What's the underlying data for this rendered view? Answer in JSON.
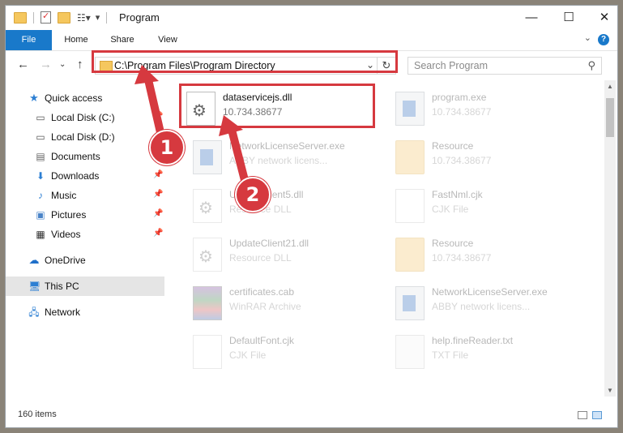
{
  "window": {
    "title": "Program",
    "controls": {
      "minimize": "—",
      "maximize": "☐",
      "close": "✕"
    }
  },
  "ribbon": {
    "tabs": [
      {
        "label": "File"
      },
      {
        "label": "Home"
      },
      {
        "label": "Share"
      },
      {
        "label": "View"
      }
    ],
    "help": "?"
  },
  "nav": {
    "address": "C:\\Program Files\\Program Directory",
    "search_placeholder": "Search Program"
  },
  "sidebar": {
    "items": [
      {
        "label": "Quick access",
        "icon": "star-icon"
      },
      {
        "label": "Local Disk (C:)",
        "icon": "drive-icon"
      },
      {
        "label": "Local Disk (D:)",
        "icon": "drive-icon"
      },
      {
        "label": "Documents",
        "icon": "documents-icon"
      },
      {
        "label": "Downloads",
        "icon": "download-icon"
      },
      {
        "label": "Music",
        "icon": "music-icon"
      },
      {
        "label": "Pictures",
        "icon": "pictures-icon"
      },
      {
        "label": "Videos",
        "icon": "videos-icon"
      },
      {
        "label": "OneDrive",
        "icon": "cloud-icon"
      },
      {
        "label": "This PC",
        "icon": "computer-icon"
      },
      {
        "label": "Network",
        "icon": "network-icon"
      }
    ]
  },
  "files": [
    {
      "name": "dataservicejs.dll",
      "sub": "10.734.38677"
    },
    {
      "name": "program.exe",
      "sub": "10.734.38677"
    },
    {
      "name": "NetworkLicenseServer.exe",
      "sub": "ABBY network licens..."
    },
    {
      "name": "Resource",
      "sub": "10.734.38677"
    },
    {
      "name": "UpdateClient5.dll",
      "sub": "Resource DLL"
    },
    {
      "name": "FastNml.cjk",
      "sub": "CJK File"
    },
    {
      "name": "UpdateClient21.dll",
      "sub": "Resource DLL"
    },
    {
      "name": "Resource",
      "sub": "10.734.38677"
    },
    {
      "name": "certificates.cab",
      "sub": "WinRAR Archive"
    },
    {
      "name": "NetworkLicenseServer.exe",
      "sub": "ABBY network licens..."
    },
    {
      "name": "DefaultFont.cjk",
      "sub": "CJK File"
    },
    {
      "name": "help.fineReader.txt",
      "sub": "TXT File"
    }
  ],
  "status": {
    "count": "160 items"
  },
  "callouts": {
    "step1": "1",
    "step2": "2",
    "color": "#d6393f"
  }
}
